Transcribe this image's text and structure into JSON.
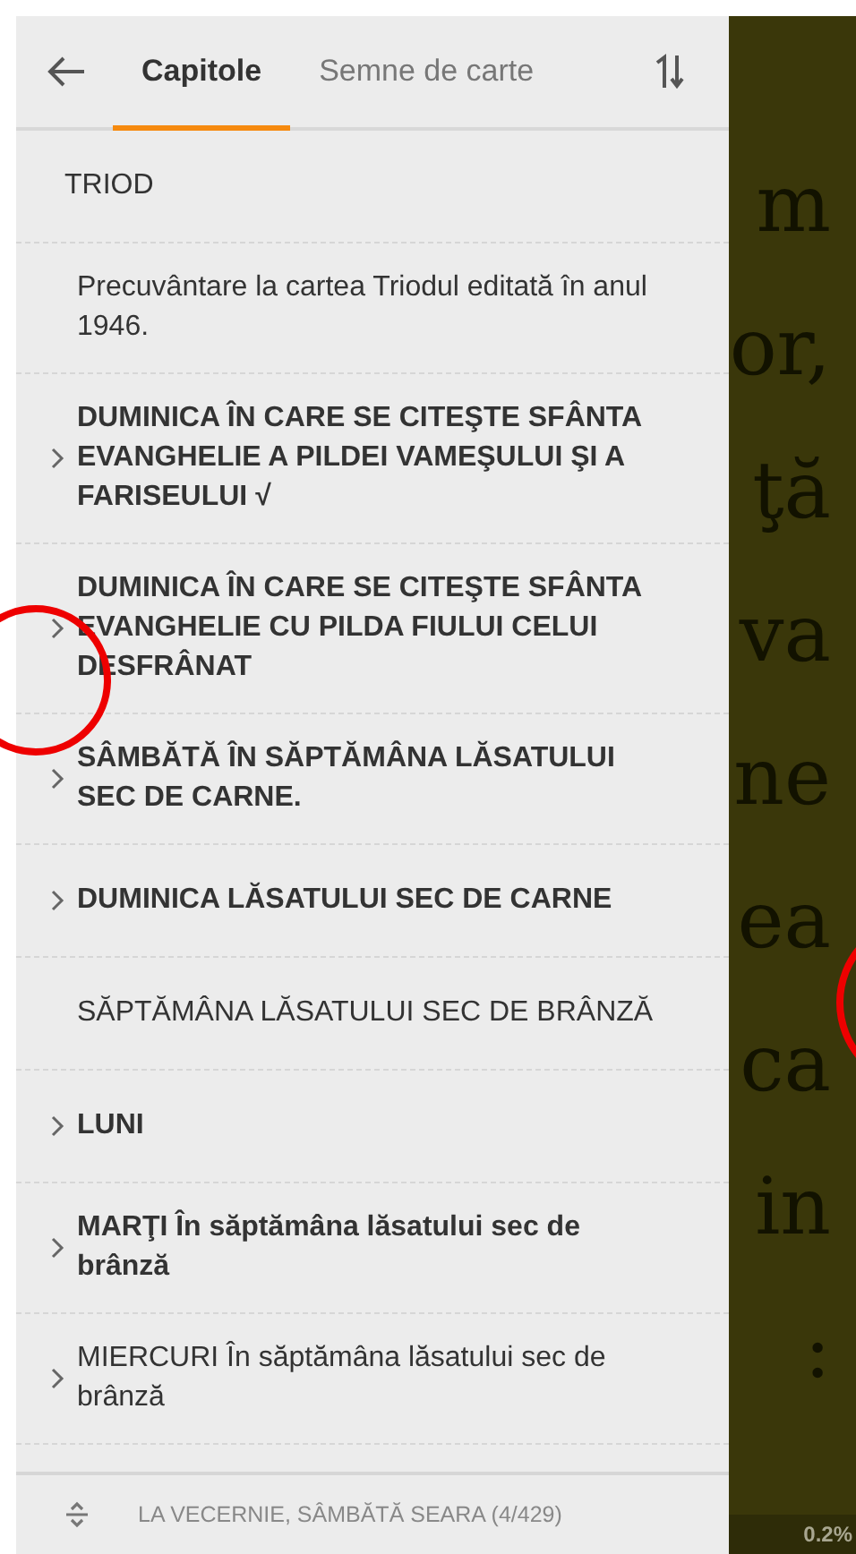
{
  "tabs": [
    {
      "label": "Capitole",
      "selected": true
    },
    {
      "label": "Semne de carte",
      "selected": false
    }
  ],
  "chapters": [
    {
      "kind": "heading",
      "title": "TRIOD",
      "expandable": false,
      "bold": false
    },
    {
      "kind": "entry",
      "title": "Precuvântare la cartea Triodul editată în anul 1946.",
      "expandable": false,
      "bold": false
    },
    {
      "kind": "entry",
      "title": "DUMINICA ÎN CARE SE CITEŞTE SFÂNTA EVANGHELIE A PILDEI VAMEŞULUI ŞI A FARISEULUI √",
      "expandable": true,
      "bold": true
    },
    {
      "kind": "entry",
      "title": "DUMINICA ÎN CARE SE CITEŞTE SFÂNTA EVANGHELIE CU PILDA FIULUI CELUI DESFRÂNAT",
      "expandable": true,
      "bold": true
    },
    {
      "kind": "entry",
      "title": "SÂMBĂTĂ ÎN SĂPTĂMÂNA LĂSATULUI SEC DE CARNE.",
      "expandable": true,
      "bold": true
    },
    {
      "kind": "entry",
      "title": "DUMINICA LĂSATULUI SEC DE CARNE",
      "expandable": true,
      "bold": true
    },
    {
      "kind": "entry",
      "title": "SĂPTĂMÂNA LĂSATULUI SEC DE BRÂNZĂ",
      "expandable": false,
      "bold": false
    },
    {
      "kind": "entry",
      "title": "LUNI",
      "expandable": true,
      "bold": true
    },
    {
      "kind": "entry",
      "title": "MARŢI În săptămâna lăsatului sec de brânză",
      "expandable": true,
      "bold": true
    },
    {
      "kind": "entry",
      "title": "MIERCURI În săptămâna lăsatului sec de brânză",
      "expandable": true,
      "bold": false
    }
  ],
  "footer": {
    "current": "LA VECERNIE, SÂMBĂTĂ SEARA (4/429)"
  },
  "reader": {
    "lines": [
      "m",
      "or,",
      "ţă",
      "va",
      "ne",
      "ea",
      "ca",
      "in",
      ":"
    ],
    "progress": "0.2%"
  }
}
